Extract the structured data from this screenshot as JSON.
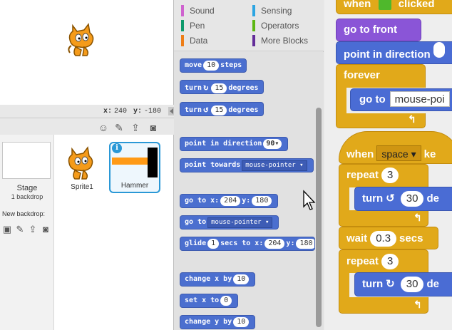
{
  "stage": {
    "x_label": "x:",
    "x_value": "240",
    "y_label": "y:",
    "y_value": "-180"
  },
  "sprites_pane": {
    "stage_label": "Stage",
    "stage_sub": "1 backdrop",
    "new_backdrop": "New backdrop:",
    "sprites": [
      {
        "name": "Sprite1"
      },
      {
        "name": "Hammer"
      }
    ]
  },
  "categories": [
    {
      "label": "Sound",
      "color": "#cf63cf"
    },
    {
      "label": "Sensing",
      "color": "#2ca5e2"
    },
    {
      "label": "Pen",
      "color": "#0e9a6c"
    },
    {
      "label": "Operators",
      "color": "#5cb712"
    },
    {
      "label": "Data",
      "color": "#ee7d16"
    },
    {
      "label": "More Blocks",
      "color": "#632d99"
    }
  ],
  "palette": {
    "move": {
      "pre": "move",
      "val": "10",
      "post": "steps"
    },
    "turn_right": {
      "pre": "turn",
      "val": "15",
      "post": "degrees"
    },
    "turn_left": {
      "pre": "turn",
      "val": "15",
      "post": "degrees"
    },
    "point_direction": {
      "pre": "point in direction",
      "val": "90▾"
    },
    "point_towards": {
      "pre": "point towards",
      "val": "mouse-pointer ▾"
    },
    "go_to_xy": {
      "pre": "go to x:",
      "x": "204",
      "mid": "y:",
      "y": "180"
    },
    "go_to": {
      "pre": "go to",
      "val": "mouse-pointer ▾"
    },
    "glide": {
      "pre": "glide",
      "secs": "1",
      "mid1": "secs to x:",
      "x": "204",
      "mid2": "y:",
      "y": "180"
    },
    "change_x": {
      "pre": "change x by",
      "val": "10"
    },
    "set_x": {
      "pre": "set x to",
      "val": "0"
    },
    "change_y": {
      "pre": "change y by",
      "val": "10"
    }
  },
  "script": {
    "when_flag": {
      "pre": "when",
      "post": "clicked"
    },
    "go_front": "go to front",
    "point_dir": "point in direction",
    "forever": "forever",
    "go_to": {
      "pre": "go to",
      "val": "mouse-poi"
    },
    "when_key": {
      "pre": "when",
      "val": "space",
      "post": "ke"
    },
    "repeat1": {
      "pre": "repeat",
      "val": "3"
    },
    "turn1": {
      "pre": "turn",
      "val": "30",
      "post": "de"
    },
    "wait": {
      "pre": "wait",
      "val": "0.3",
      "post": "secs"
    },
    "repeat2": {
      "pre": "repeat",
      "val": "3"
    },
    "turn2": {
      "pre": "turn",
      "val": "30",
      "post": "de"
    }
  }
}
